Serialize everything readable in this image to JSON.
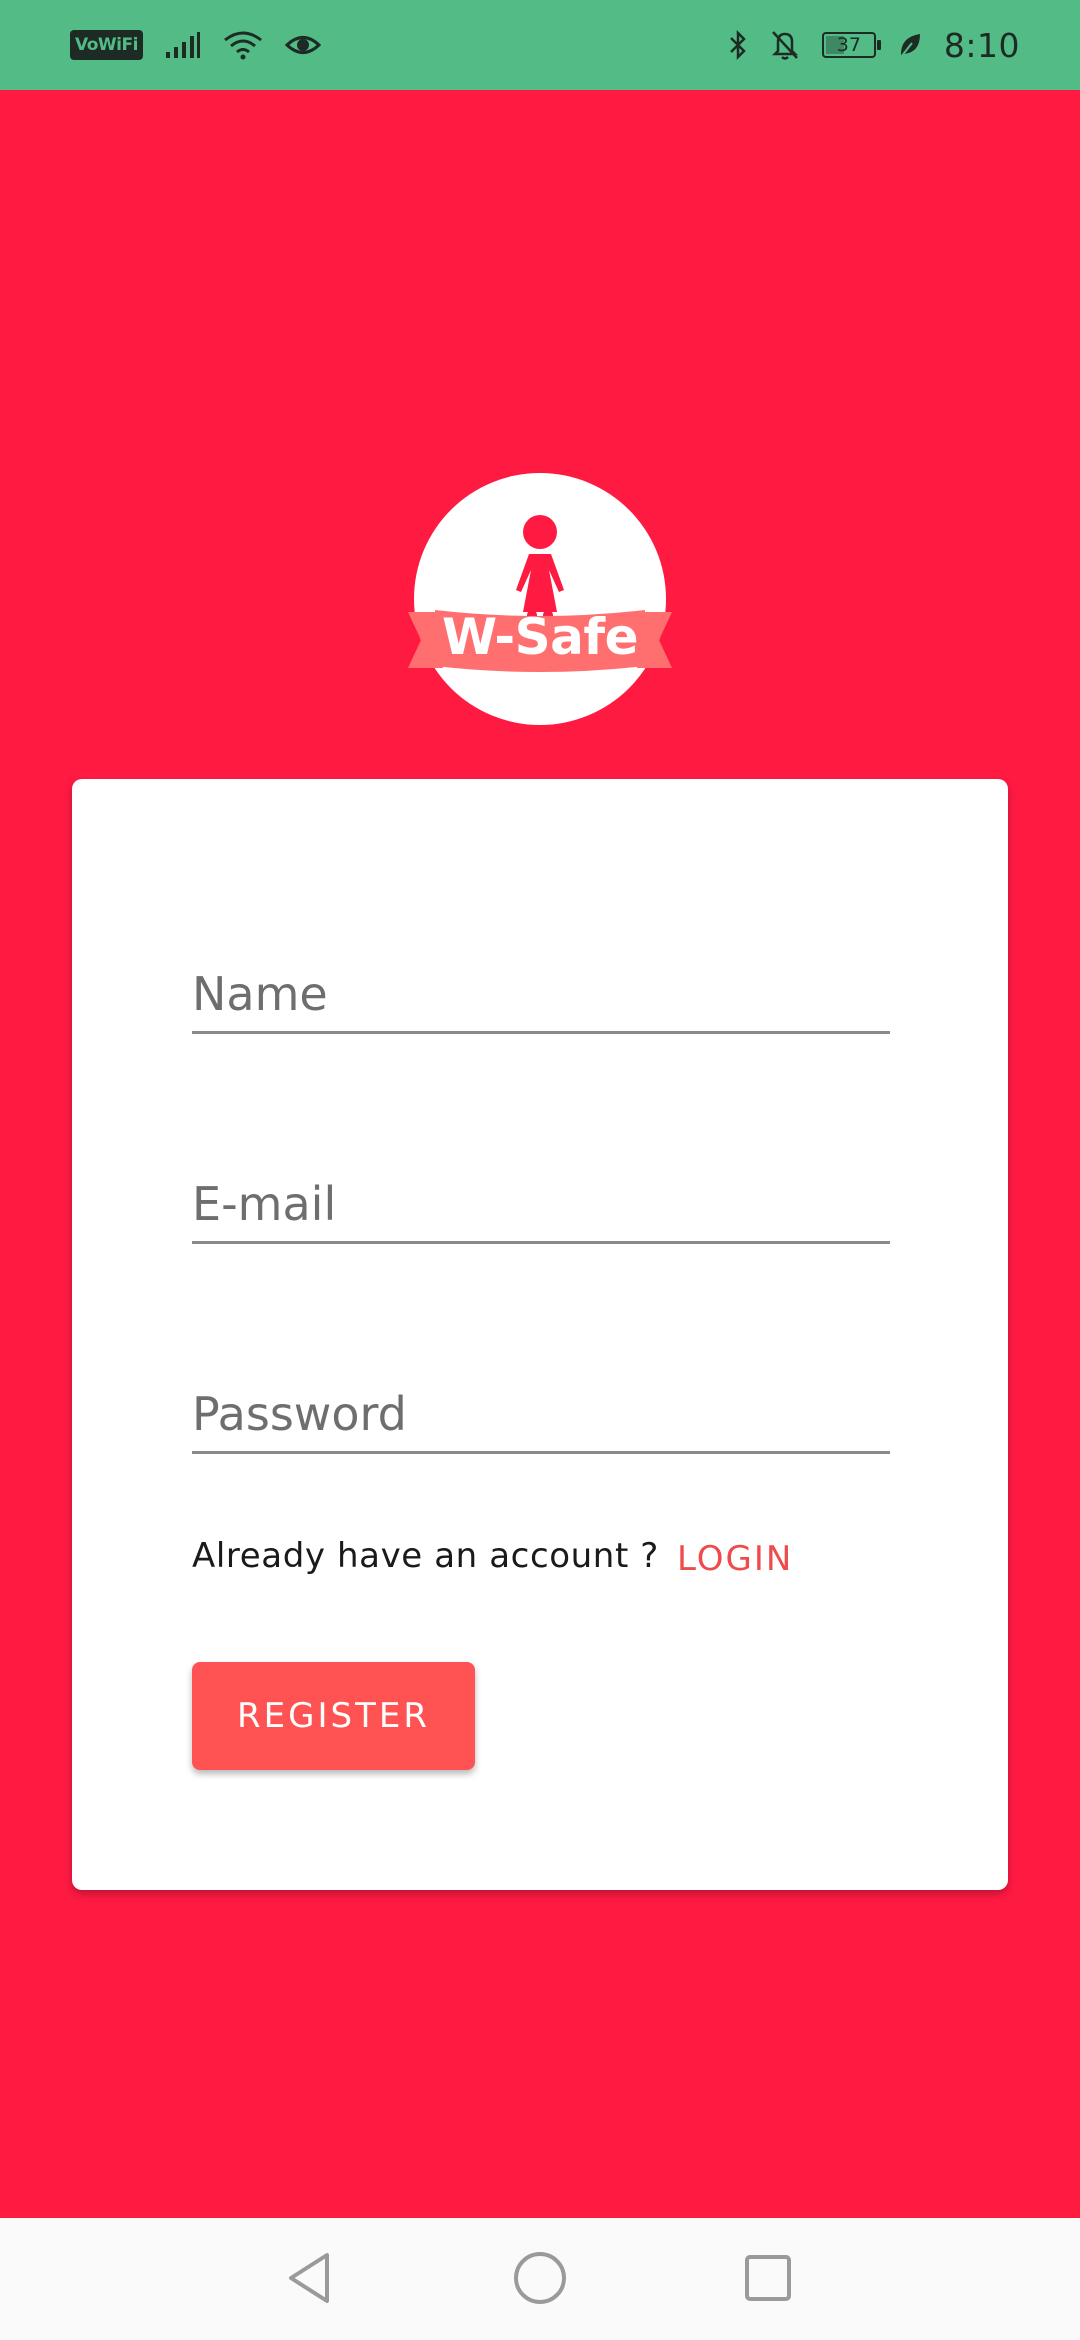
{
  "status_bar": {
    "network_badge": "VoWiFi",
    "battery_level": "37",
    "battery_fraction": 0.37,
    "time": "8:10",
    "icons": [
      "signal-icon",
      "wifi-icon",
      "eye-icon",
      "bluetooth-icon",
      "bell-off-icon",
      "battery-icon",
      "leaf-icon"
    ]
  },
  "logo": {
    "text": "W-Safe",
    "colors": {
      "circle": "#ffffff",
      "figure": "#ff1a42",
      "ribbon": "#ff6f6f"
    }
  },
  "form": {
    "name_placeholder": "Name",
    "email_placeholder": "E-mail",
    "password_placeholder": "Password",
    "name_value": "",
    "email_value": "",
    "password_value": ""
  },
  "account_prompt": "Already have an account ?",
  "login_label": "LOGIN",
  "register_label": "REGISTER",
  "colors": {
    "background": "#ff1a42",
    "status_bar": "#52bb86",
    "accent_button": "#ff5252",
    "link": "#ef4b4b"
  },
  "nav": {
    "icons": [
      "back-icon",
      "home-icon",
      "recent-apps-icon"
    ]
  }
}
